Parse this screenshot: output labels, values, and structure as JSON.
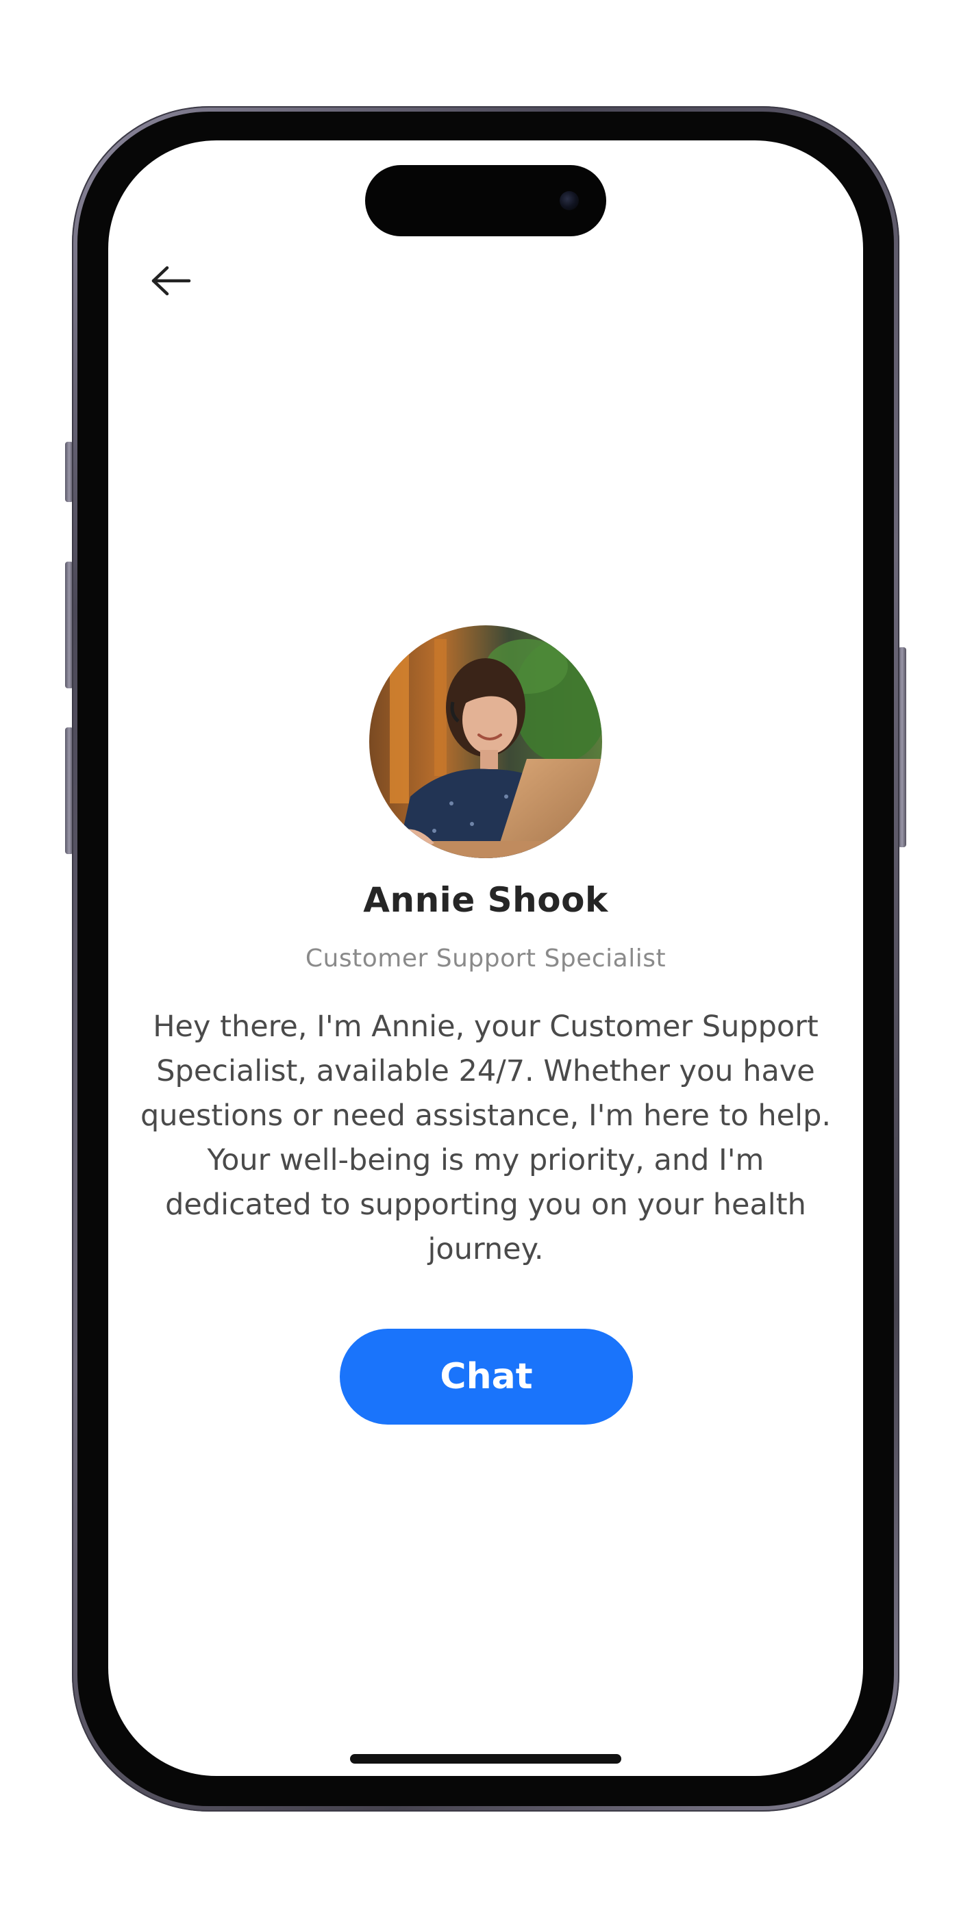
{
  "header": {
    "back_icon": "arrow-left-icon"
  },
  "profile": {
    "avatar_description_icon": "avatar-photo",
    "name": "Annie Shook",
    "role": "Customer Support Specialist",
    "bio": "Hey there, I'm Annie, your Customer Support Specialist, available 24/7. Whether you have questions or need assistance, I'm here to help. Your well-being is my priority, and I'm dedicated to supporting you on your health journey."
  },
  "actions": {
    "chat_label": "Chat"
  },
  "colors": {
    "accent": "#1a74fb",
    "name_text": "#262626",
    "role_text": "#8a8a8a",
    "bio_text": "#4a4a4a",
    "background": "#ffffff"
  }
}
